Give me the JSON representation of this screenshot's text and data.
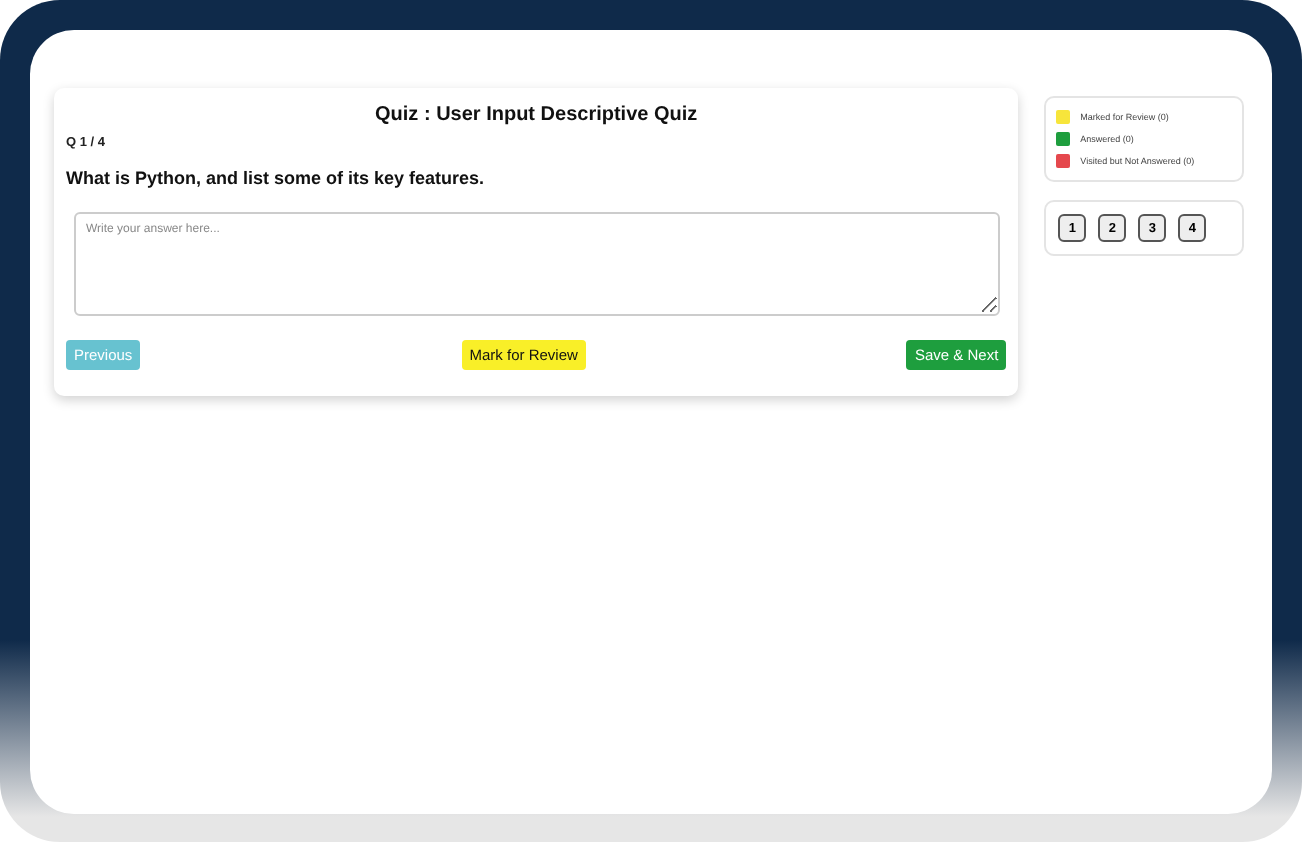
{
  "quiz": {
    "title": "Quiz : User Input Descriptive Quiz",
    "progress": "Q 1 / 4",
    "question": "What is Python, and list some of its key features.",
    "answer": {
      "placeholder": "Write your answer here..."
    },
    "buttons": [
      {
        "kind": "previous",
        "label": "Previous",
        "disabled": true
      },
      {
        "kind": "review",
        "label": "Mark for Review",
        "disabled": false
      },
      {
        "kind": "next",
        "label": "Save & Next",
        "disabled": false
      }
    ]
  },
  "legend": [
    {
      "label": "Marked for Review (0)",
      "color": "#f7e53b"
    },
    {
      "label": "Answered (0)",
      "color": "#1e9e3e"
    },
    {
      "label": "Visited but Not Answered (0)",
      "color": "#e5484d"
    }
  ],
  "question_numbers": [
    "1",
    "2",
    "3",
    "4"
  ]
}
